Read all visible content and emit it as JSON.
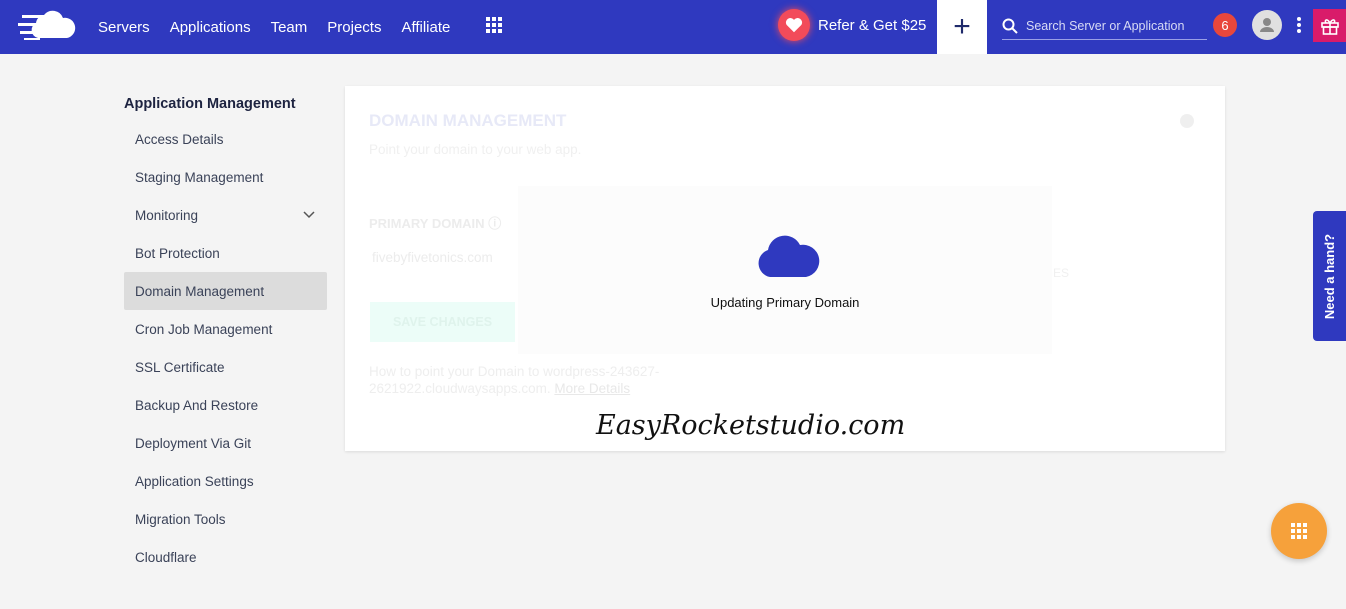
{
  "nav": {
    "links": [
      "Servers",
      "Applications",
      "Team",
      "Projects",
      "Affiliate"
    ],
    "refer_label": "Refer & Get $25",
    "search_placeholder": "Search Server or Application",
    "notification_count": "6"
  },
  "sidebar": {
    "heading": "Application Management",
    "items": [
      "Access Details",
      "Staging Management",
      "Monitoring",
      "Bot Protection",
      "Domain Management",
      "Cron Job Management",
      "SSL Certificate",
      "Backup And Restore",
      "Deployment Via Git",
      "Application Settings",
      "Migration Tools",
      "Cloudflare"
    ],
    "active": "Domain Management"
  },
  "main": {
    "title": "DOMAIN MANAGEMENT",
    "subtitle": "Point your domain to your web app.",
    "primary_label": "PRIMARY DOMAIN",
    "primary_value": "fivebyfivetonics.com",
    "save_label": "SAVE CHANGES",
    "save_partial": "NGES",
    "how_text": "How to point your Domain to wordpress-243627-2621922.cloudwaysapps.com.",
    "more_details": "More Details"
  },
  "overlay": {
    "message": "Updating Primary Domain"
  },
  "watermark": "EasyRocketstudio.com",
  "help_tab": "Need a hand?",
  "colors": {
    "brand": "#2f39bf",
    "accent": "#f6a13b",
    "gift": "#d91b6a"
  }
}
